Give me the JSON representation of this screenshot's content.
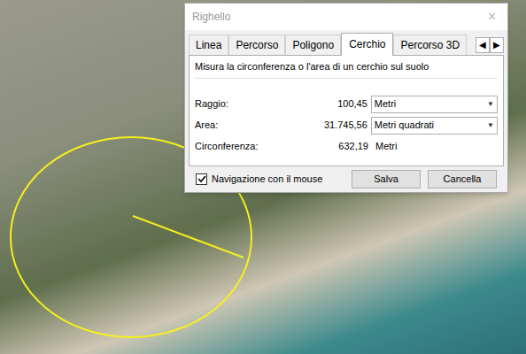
{
  "map": {
    "measurement": {
      "shape": "circle"
    }
  },
  "window": {
    "title": "Righello",
    "close": "✕"
  },
  "tabs": [
    {
      "label": "Linea",
      "selected": false
    },
    {
      "label": "Percorso",
      "selected": false
    },
    {
      "label": "Poligono",
      "selected": false
    },
    {
      "label": "Cerchio",
      "selected": true
    },
    {
      "label": "Percorso 3D",
      "selected": false
    }
  ],
  "tab_scroll": [
    "◀",
    "▶"
  ],
  "description": "Misura la circonferenza o l'area di un cerchio sul suolo",
  "rows": [
    {
      "kind": "select",
      "label": "Raggio:",
      "value": "100,45",
      "unit": "Metri",
      "arrow": "▼"
    },
    {
      "kind": "select",
      "label": "Area:",
      "value": "31.745,56",
      "unit": "Metri quadrati",
      "arrow": "▼"
    },
    {
      "kind": "text",
      "label": "Circonferenza:",
      "value": "632,19",
      "unit": "Metri"
    }
  ],
  "mouse_navigation": {
    "label": "Navigazione con il mouse",
    "checked": true
  },
  "buttons": [
    "Salva",
    "Cancella"
  ]
}
